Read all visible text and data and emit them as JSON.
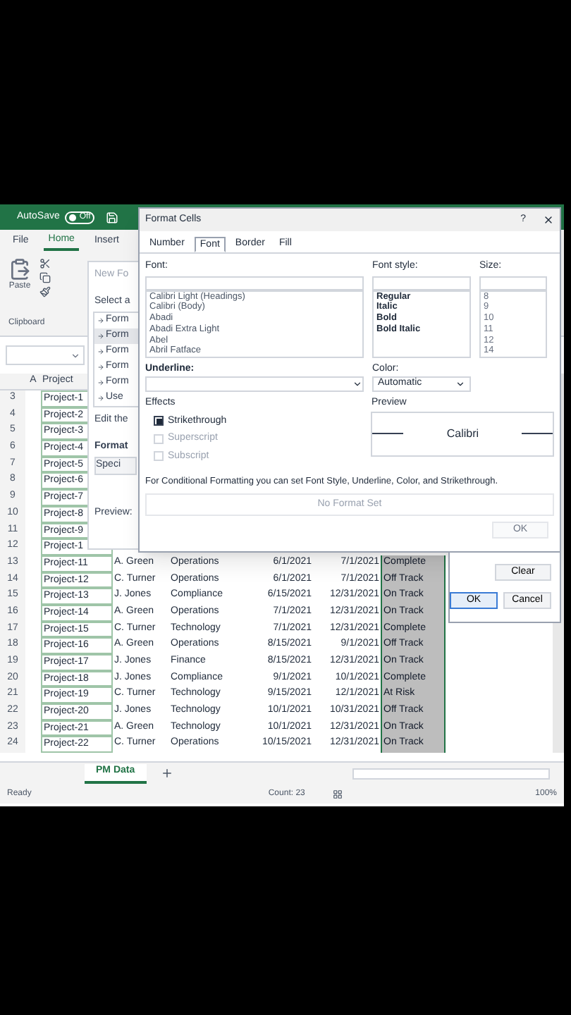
{
  "title_bar": {
    "autosave_label": "AutoSave",
    "autosave_toggle": {
      "label": "Off",
      "on": false
    }
  },
  "ribbon_tabs": [
    {
      "label": "File",
      "selected": false
    },
    {
      "label": "Home",
      "selected": true
    },
    {
      "label": "Insert",
      "selected": false
    }
  ],
  "ribbon": {
    "paste_label": "Paste",
    "group_label": "Clipboard"
  },
  "sheet": {
    "column_letters": [
      "A"
    ],
    "columns": [
      "Project"
    ],
    "rows": [
      {
        "number": "3",
        "cells": [
          "Project-1"
        ]
      },
      {
        "number": "4",
        "cells": [
          "Project-2"
        ]
      },
      {
        "number": "5",
        "cells": [
          "Project-3"
        ]
      },
      {
        "number": "6",
        "cells": [
          "Project-4"
        ]
      },
      {
        "number": "7",
        "cells": [
          "Project-5"
        ]
      },
      {
        "number": "8",
        "cells": [
          "Project-6"
        ]
      },
      {
        "number": "9",
        "cells": [
          "Project-7"
        ]
      },
      {
        "number": "10",
        "cells": [
          "Project-8"
        ]
      },
      {
        "number": "11",
        "cells": [
          "Project-9"
        ]
      },
      {
        "number": "12",
        "cells": [
          "Project-1"
        ]
      },
      {
        "number": "13",
        "cells": [
          "Project-11",
          "A. Green",
          "Operations",
          "6/1/2021",
          "7/1/2021"
        ],
        "status": {
          "text": "Complete",
          "selected": true
        }
      },
      {
        "number": "14",
        "cells": [
          "Project-12",
          "C. Turner",
          "Operations",
          "6/1/2021",
          "7/1/2021"
        ],
        "status": {
          "text": "Off Track",
          "selected": true
        }
      },
      {
        "number": "15",
        "cells": [
          "Project-13",
          "J. Jones",
          "Compliance",
          "6/15/2021",
          "12/31/2021"
        ],
        "status": {
          "text": "On Track",
          "selected": true
        }
      },
      {
        "number": "16",
        "cells": [
          "Project-14",
          "A. Green",
          "Operations",
          "7/1/2021",
          "12/31/2021"
        ],
        "status": {
          "text": "On Track",
          "selected": true
        }
      },
      {
        "number": "17",
        "cells": [
          "Project-15",
          "C. Turner",
          "Technology",
          "7/1/2021",
          "12/31/2021"
        ],
        "status": {
          "text": "Complete",
          "selected": true
        }
      },
      {
        "number": "18",
        "cells": [
          "Project-16",
          "A. Green",
          "Operations",
          "8/15/2021",
          "9/1/2021"
        ],
        "status": {
          "text": "Off Track",
          "selected": true
        }
      },
      {
        "number": "19",
        "cells": [
          "Project-17",
          "J. Jones",
          "Finance",
          "8/15/2021",
          "12/31/2021"
        ],
        "status": {
          "text": "On Track",
          "selected": true
        }
      },
      {
        "number": "20",
        "cells": [
          "Project-18",
          "J. Jones",
          "Compliance",
          "9/1/2021",
          "10/1/2021"
        ],
        "status": {
          "text": "Complete",
          "selected": true
        }
      },
      {
        "number": "21",
        "cells": [
          "Project-19",
          "C. Turner",
          "Technology",
          "9/15/2021",
          "12/1/2021"
        ],
        "status": {
          "text": "At Risk",
          "selected": true
        }
      },
      {
        "number": "22",
        "cells": [
          "Project-20",
          "J. Jones",
          "Technology",
          "10/1/2021",
          "10/31/2021"
        ],
        "status": {
          "text": "Off Track",
          "selected": true
        }
      },
      {
        "number": "23",
        "cells": [
          "Project-21",
          "A. Green",
          "Technology",
          "10/1/2021",
          "12/31/2021"
        ],
        "status": {
          "text": "On Track",
          "selected": true
        }
      },
      {
        "number": "24",
        "cells": [
          "Project-22",
          "C. Turner",
          "Operations",
          "10/15/2021",
          "12/31/2021"
        ],
        "status": {
          "text": "On Track",
          "selected": true
        }
      }
    ]
  },
  "sheet_tabs": [
    {
      "label": "PM Data",
      "selected": true
    }
  ],
  "status_bar": {
    "mode": "Ready",
    "count": "Count: 23",
    "zoom": "100%"
  },
  "rule_dialog": {
    "title": "New Fo",
    "select_label": "Select a",
    "rule_types": [
      {
        "label": "Form",
        "selected": false
      },
      {
        "label": "Form",
        "selected": true
      },
      {
        "label": "Form",
        "selected": false
      },
      {
        "label": "Form",
        "selected": false
      },
      {
        "label": "Form",
        "selected": false
      },
      {
        "label": "Use",
        "selected": false
      }
    ],
    "edit_label": "Edit the",
    "format_label": "Format",
    "condition_value": "Speci",
    "preview_label": "Preview:"
  },
  "format_dialog": {
    "title": "Format Cells",
    "help": "?",
    "tabs": [
      {
        "label": "Number",
        "selected": false
      },
      {
        "label": "Font",
        "selected": true
      },
      {
        "label": "Border",
        "selected": false
      },
      {
        "label": "Fill",
        "selected": false
      }
    ],
    "font_label": "Font:",
    "fonts": [
      "Calibri Light (Headings)",
      "Calibri (Body)",
      "Abadi",
      "Abadi Extra Light",
      "Abel",
      "Abril Fatface"
    ],
    "font_style_label": "Font style:",
    "font_styles": [
      "Regular",
      "Italic",
      "Bold",
      "Bold Italic"
    ],
    "size_label": "Size:",
    "sizes": [
      "8",
      "9",
      "10",
      "11",
      "12",
      "14"
    ],
    "underline_label": "Underline:",
    "color_label": "Color:",
    "color_value": "Automatic",
    "effects_label": "Effects",
    "effects": [
      {
        "label": "Strikethrough",
        "checked": true,
        "disabled": false
      },
      {
        "label": "Superscript",
        "checked": false,
        "disabled": true
      },
      {
        "label": "Subscript",
        "checked": false,
        "disabled": true
      }
    ],
    "preview_label": "Preview",
    "preview_text": "Calibri",
    "note": "For Conditional Formatting you can set Font Style, Underline, Color, and Strikethrough.",
    "rule_preview": "No Format Set",
    "rule_buttons": [
      {
        "label": "OK",
        "disabled": true
      },
      {
        "label": "Clear",
        "disabled": false
      }
    ],
    "buttons": [
      {
        "label": "OK",
        "default": true
      },
      {
        "label": "Cancel",
        "default": false
      }
    ]
  }
}
